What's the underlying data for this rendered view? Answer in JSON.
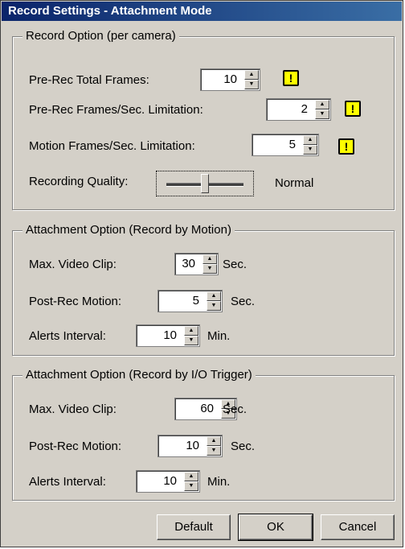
{
  "window": {
    "title": "Record Settings - Attachment Mode"
  },
  "record_option": {
    "title": "Record Option (per camera)",
    "pre_rec_total_frames": {
      "label": "Pre-Rec Total Frames:",
      "value": "10"
    },
    "pre_rec_fps_limit": {
      "label": "Pre-Rec Frames/Sec. Limitation:",
      "value": "2"
    },
    "motion_fps_limit": {
      "label": "Motion Frames/Sec. Limitation:",
      "value": "5"
    },
    "recording_quality": {
      "label": "Recording Quality:",
      "value": "Normal"
    }
  },
  "attachment_motion": {
    "title": "Attachment Option (Record by Motion)",
    "max_video_clip": {
      "label": "Max. Video Clip:",
      "value": "30",
      "unit": "Sec."
    },
    "post_rec_motion": {
      "label": "Post-Rec Motion:",
      "value": "5",
      "unit": "Sec."
    },
    "alerts_interval": {
      "label": "Alerts Interval:",
      "value": "10",
      "unit": "Min."
    }
  },
  "attachment_io": {
    "title": "Attachment Option (Record by I/O Trigger)",
    "max_video_clip": {
      "label": "Max. Video Clip:",
      "value": "60",
      "unit": "Sec."
    },
    "post_rec_motion": {
      "label": "Post-Rec Motion:",
      "value": "10",
      "unit": "Sec."
    },
    "alerts_interval": {
      "label": "Alerts Interval:",
      "value": "10",
      "unit": "Min."
    }
  },
  "buttons": {
    "default": "Default",
    "ok": "OK",
    "cancel": "Cancel"
  },
  "icons": {
    "warning": "warning-icon",
    "spin_up": "spin-up-icon",
    "spin_down": "spin-down-icon"
  },
  "colors": {
    "titlebar_start": "#0a246a",
    "titlebar_end": "#3a6ea5",
    "dialog_bg": "#d4d0c8",
    "warning_bg": "#ffff00"
  }
}
